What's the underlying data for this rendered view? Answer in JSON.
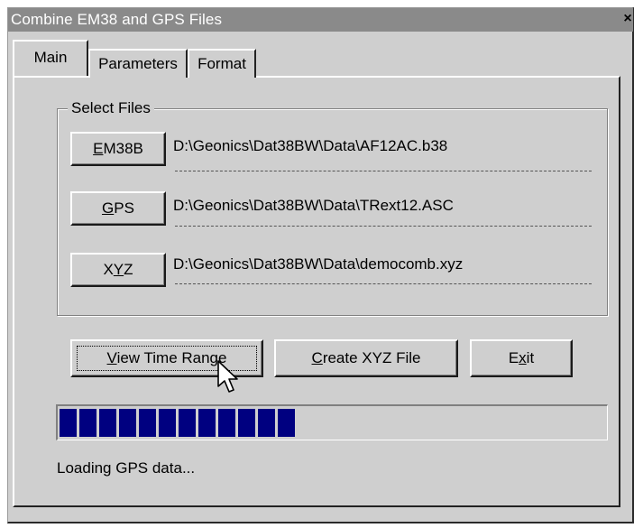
{
  "window": {
    "title": "Combine EM38 and GPS Files",
    "close_glyph": "×"
  },
  "tabs": [
    {
      "label": "Main",
      "active": true
    },
    {
      "label": "Parameters",
      "active": false
    },
    {
      "label": "Format",
      "active": false
    }
  ],
  "select_files": {
    "legend": "Select Files",
    "rows": [
      {
        "button_label": "EM38B",
        "mnemonic": "E",
        "path": "D:\\Geonics\\Dat38BW\\Data\\AF12AC.b38"
      },
      {
        "button_label": "GPS",
        "mnemonic": "G",
        "path": "D:\\Geonics\\Dat38BW\\Data\\TRext12.ASC"
      },
      {
        "button_label": "XYZ",
        "mnemonic": "Y",
        "path": "D:\\Geonics\\Dat38BW\\Data\\democomb.xyz"
      }
    ]
  },
  "actions": {
    "view_time_range": "View Time Range",
    "create_xyz_file": "Create XYZ File",
    "exit": "Exit"
  },
  "progress": {
    "fraction": 0.43,
    "segment_color": "#000080"
  },
  "status_text": "Loading GPS data...",
  "colors": {
    "face": "#cfcfcf",
    "titlebar": "#8a8a8a",
    "progress": "#000080"
  },
  "icons": {
    "cursor": "mouse-pointer-icon",
    "close": "close-icon"
  }
}
